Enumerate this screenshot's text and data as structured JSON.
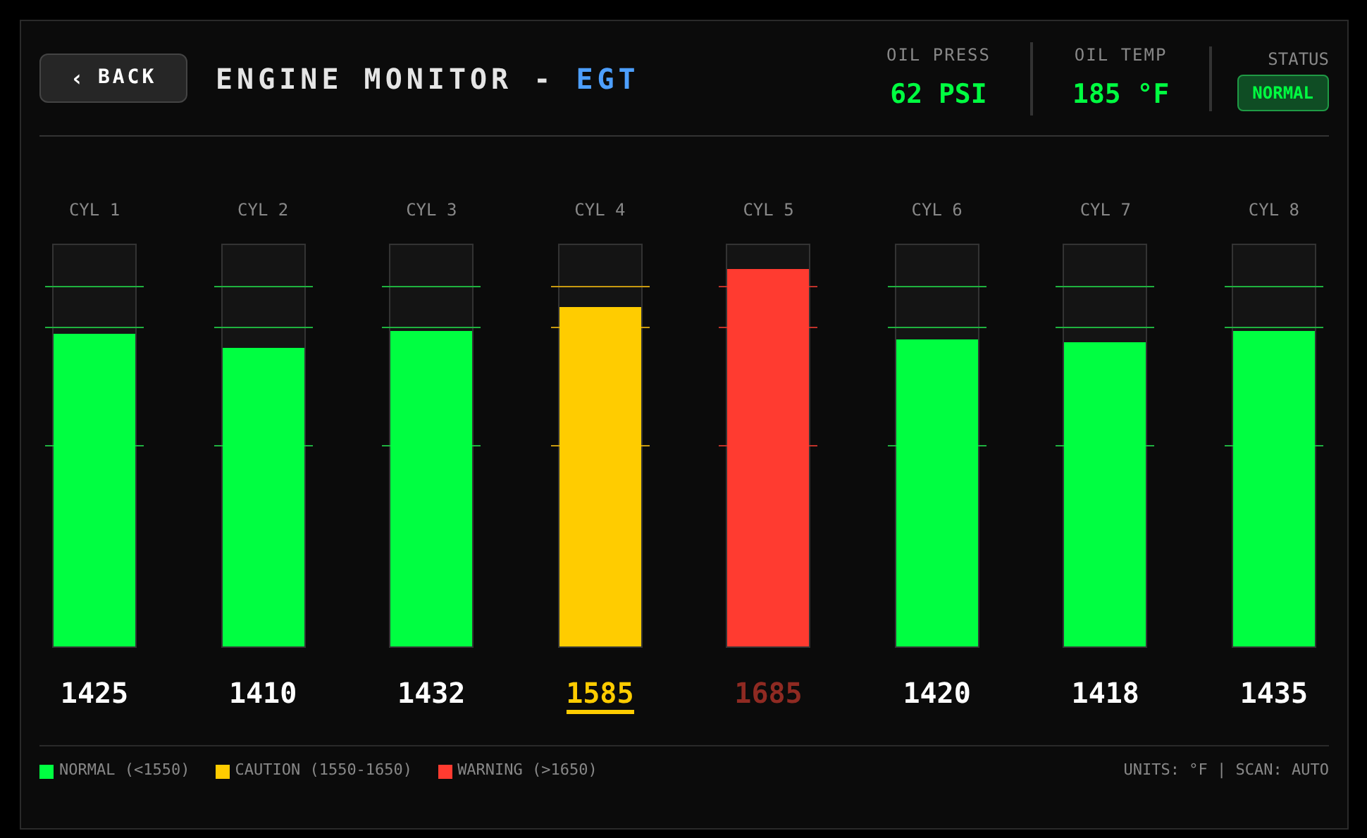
{
  "header": {
    "back_button": {
      "icon": "‹",
      "label": "BACK"
    },
    "title": "ENGINE MONITOR - ",
    "title_accent": "EGT"
  },
  "readouts": [
    {
      "label": "OIL PRESS",
      "value": "62 PSI"
    },
    {
      "label": "OIL TEMP",
      "value": "185 °F"
    }
  ],
  "status": {
    "label": "STATUS",
    "badge": "NORMAL"
  },
  "cylinders": [
    {
      "label": "CYL 1",
      "kind": "normal",
      "level": 0.78,
      "value": "1425",
      "selected": false
    },
    {
      "label": "CYL 2",
      "kind": "normal",
      "level": 0.745,
      "value": "1410",
      "selected": false
    },
    {
      "label": "CYL 3",
      "kind": "normal",
      "level": 0.787,
      "value": "1432",
      "selected": false
    },
    {
      "label": "CYL 4",
      "kind": "caution",
      "level": 0.846,
      "value": "1585",
      "selected": true
    },
    {
      "label": "CYL 5",
      "kind": "warning",
      "level": 0.94,
      "value": "1685",
      "selected": false
    },
    {
      "label": "CYL 6",
      "kind": "normal",
      "level": 0.766,
      "value": "1420",
      "selected": false
    },
    {
      "label": "CYL 7",
      "kind": "normal",
      "level": 0.759,
      "value": "1418",
      "selected": false
    },
    {
      "label": "CYL 8",
      "kind": "normal",
      "level": 0.787,
      "value": "1435",
      "selected": false
    }
  ],
  "legend": [
    {
      "label": "NORMAL (<1550)",
      "color": "#00ff41"
    },
    {
      "label": "CAUTION (1550-1650)",
      "color": "#ffcc00"
    },
    {
      "label": "WARNING (>1650)",
      "color": "#ff3b30"
    }
  ],
  "footer_note": "UNITS: °F | SCAN: AUTO"
}
